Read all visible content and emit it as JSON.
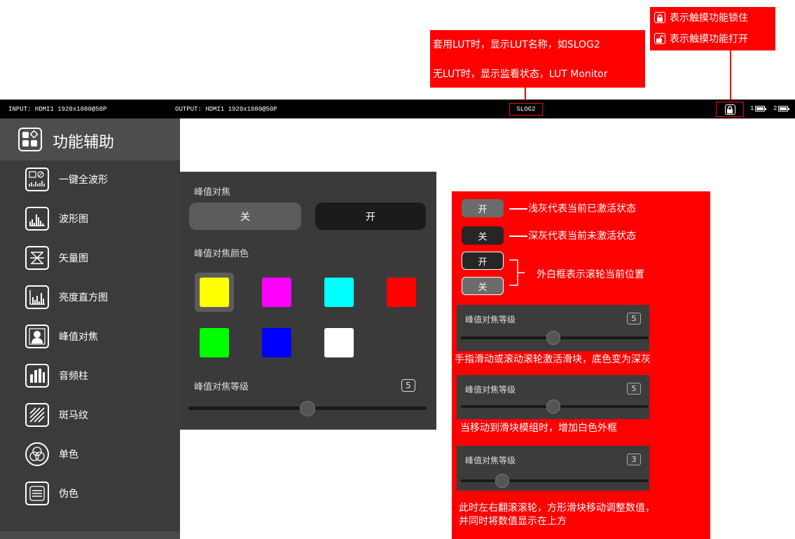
{
  "callouts": {
    "lut_line1": "套用LUT时，显示LUT名称，如SLOG2",
    "lut_line2": "无LUT时，显示监看状态，LUT Monitor",
    "lock_closed": "表示触摸功能锁住",
    "lock_open": "表示触摸功能打开"
  },
  "statusbar": {
    "input": "INPUT:  HDMI1 1920x1080@50P",
    "output": "OUTPUT:  HDMI1 1920x1080@50P",
    "lut_name": "SLOG2",
    "battery1_label": "1",
    "battery2_label": "2"
  },
  "sidebar": {
    "title": "功能辅助",
    "items": [
      {
        "label": "一键全波形",
        "icon": "waveform-all-icon"
      },
      {
        "label": "波形图",
        "icon": "waveform-icon"
      },
      {
        "label": "矢量图",
        "icon": "vectorscope-icon"
      },
      {
        "label": "亮度直方图",
        "icon": "histogram-icon"
      },
      {
        "label": "峰值对焦",
        "icon": "peaking-icon"
      },
      {
        "label": "音频柱",
        "icon": "audio-meter-icon"
      },
      {
        "label": "斑马纹",
        "icon": "zebra-icon"
      },
      {
        "label": "单色",
        "icon": "mono-icon"
      },
      {
        "label": "伪色",
        "icon": "false-color-icon"
      }
    ]
  },
  "panel": {
    "peaking_label": "峰值对焦",
    "off_label": "关",
    "on_label": "开",
    "color_label": "峰值对焦颜色",
    "colors": [
      "#ffff00",
      "#ff00ff",
      "#00ffff",
      "#ff0000",
      "#00ff00",
      "#0000ff",
      "#ffffff"
    ],
    "selected_color_index": 0,
    "level_label": "峰值对焦等级",
    "level_value": "5",
    "level_fraction": 0.5
  },
  "legend": {
    "light_on": "开",
    "light_desc": "浅灰代表当前已激活状态",
    "dark_off": "关",
    "dark_desc": "深灰代表当前未激活状态",
    "frame_on": "开",
    "frame_off": "关",
    "frame_desc": "外白框表示滚轮当前位置",
    "slider1_title": "峰值对焦等级",
    "slider1_value": "5",
    "slider1_desc": "手指滑动或滚动滚轮激活滑块，底色变为深灰",
    "slider2_title": "峰值对焦等级",
    "slider2_value": "5",
    "slider2_desc": "当移动到滑块模组时，增加白色外框",
    "slider3_title": "峰值对焦等级",
    "slider3_value": "3",
    "slider3_desc_line1": "此时左右翻滚滚轮，方形滑块移动调整数值，",
    "slider3_desc_line2": "并同时将数值显示在上方"
  }
}
